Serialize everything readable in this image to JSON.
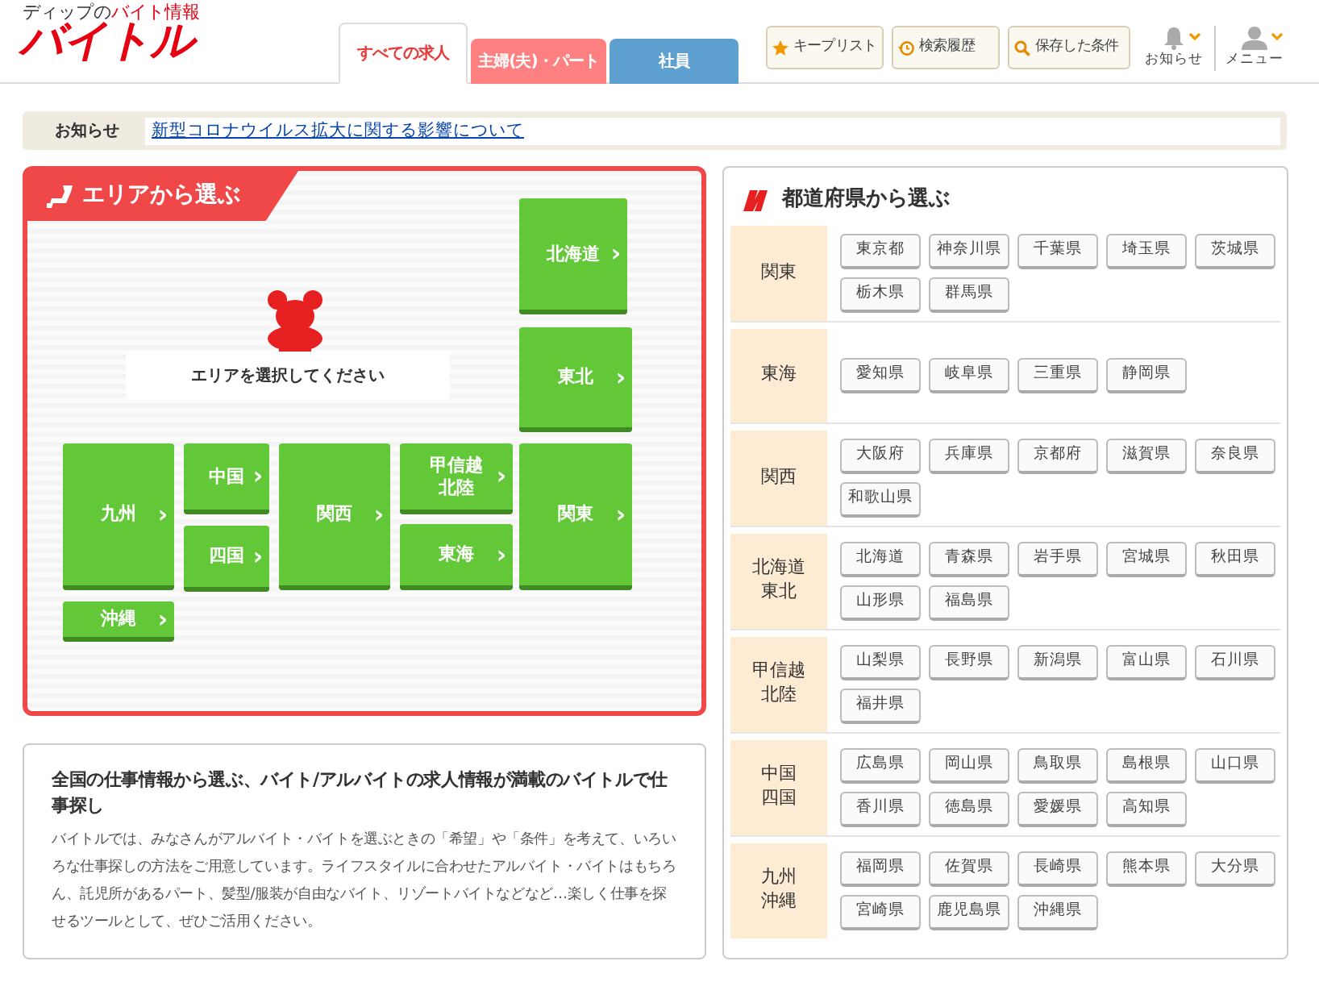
{
  "header": {
    "tagline_prefix": "ディップの",
    "tagline_highlight": "バイト情報",
    "logo": "バイトル",
    "tabs": [
      {
        "label": "すべての求人",
        "selected": true,
        "color": "#e83838"
      },
      {
        "label": "主婦(夫)・パート",
        "selected": false,
        "color": "#ff8080"
      },
      {
        "label": "社員",
        "selected": false,
        "color": "#5ea0d0"
      }
    ],
    "buttons": [
      {
        "label": "キープリスト",
        "kind": "star"
      },
      {
        "label": "検索履歴",
        "kind": "history"
      },
      {
        "label": "保存した条件",
        "kind": "search"
      }
    ],
    "icons": [
      {
        "label": "お知らせ",
        "kind": "bell"
      },
      {
        "label": "メニュー",
        "kind": "person"
      }
    ]
  },
  "notice": {
    "label": "お知らせ",
    "link": "新型コロナウイルス拡大に関する影響について"
  },
  "area_panel": {
    "title": "エリアから選ぶ",
    "message": "エリアを選択してください",
    "areas": [
      {
        "lines": [
          "北海道"
        ]
      },
      {
        "lines": [
          "東北"
        ]
      },
      {
        "lines": [
          "九州"
        ]
      },
      {
        "lines": [
          "中国"
        ]
      },
      {
        "lines": [
          "四国"
        ]
      },
      {
        "lines": [
          "関西"
        ]
      },
      {
        "lines": [
          "甲信越",
          "北陸"
        ]
      },
      {
        "lines": [
          "東海"
        ]
      },
      {
        "lines": [
          "関東"
        ]
      },
      {
        "lines": [
          "沖縄"
        ]
      }
    ],
    "arrow": "›"
  },
  "about": {
    "heading": "全国の仕事情報から選ぶ、バイト/アルバイトの求人情報が満載のバイトルで仕事探し",
    "body": "バイトルでは、みなさんがアルバイト・バイトを選ぶときの「希望」や「条件」を考えて、いろいろな仕事探しの方法をご用意しています。ライフスタイルに合わせたアルバイト・バイトはもちろん、託児所があるパート、髪型/服装が自由なバイト、リゾートバイトなどなど…楽しく仕事を探せるツールとして、ぜひご活用ください。"
  },
  "prefecture_panel": {
    "title": "都道府県から選ぶ",
    "regions": [
      {
        "lines": [
          "関東"
        ],
        "prefectures": [
          "東京都",
          "神奈川県",
          "千葉県",
          "埼玉県",
          "茨城県",
          "栃木県",
          "群馬県"
        ]
      },
      {
        "lines": [
          "東海"
        ],
        "prefectures": [
          "愛知県",
          "岐阜県",
          "三重県",
          "静岡県"
        ]
      },
      {
        "lines": [
          "関西"
        ],
        "prefectures": [
          "大阪府",
          "兵庫県",
          "京都府",
          "滋賀県",
          "奈良県",
          "和歌山県"
        ]
      },
      {
        "lines": [
          "北海道",
          "東北"
        ],
        "prefectures": [
          "北海道",
          "青森県",
          "岩手県",
          "宮城県",
          "秋田県",
          "山形県",
          "福島県"
        ]
      },
      {
        "lines": [
          "甲信越",
          "北陸"
        ],
        "prefectures": [
          "山梨県",
          "長野県",
          "新潟県",
          "富山県",
          "石川県",
          "福井県"
        ]
      },
      {
        "lines": [
          "中国",
          "四国"
        ],
        "prefectures": [
          "広島県",
          "岡山県",
          "鳥取県",
          "島根県",
          "山口県",
          "香川県",
          "徳島県",
          "愛媛県",
          "高知県"
        ]
      },
      {
        "lines": [
          "九州",
          "沖縄"
        ],
        "prefectures": [
          "福岡県",
          "佐賀県",
          "長崎県",
          "熊本県",
          "大分県",
          "宮崎県",
          "鹿児島県",
          "沖縄県"
        ]
      }
    ]
  }
}
